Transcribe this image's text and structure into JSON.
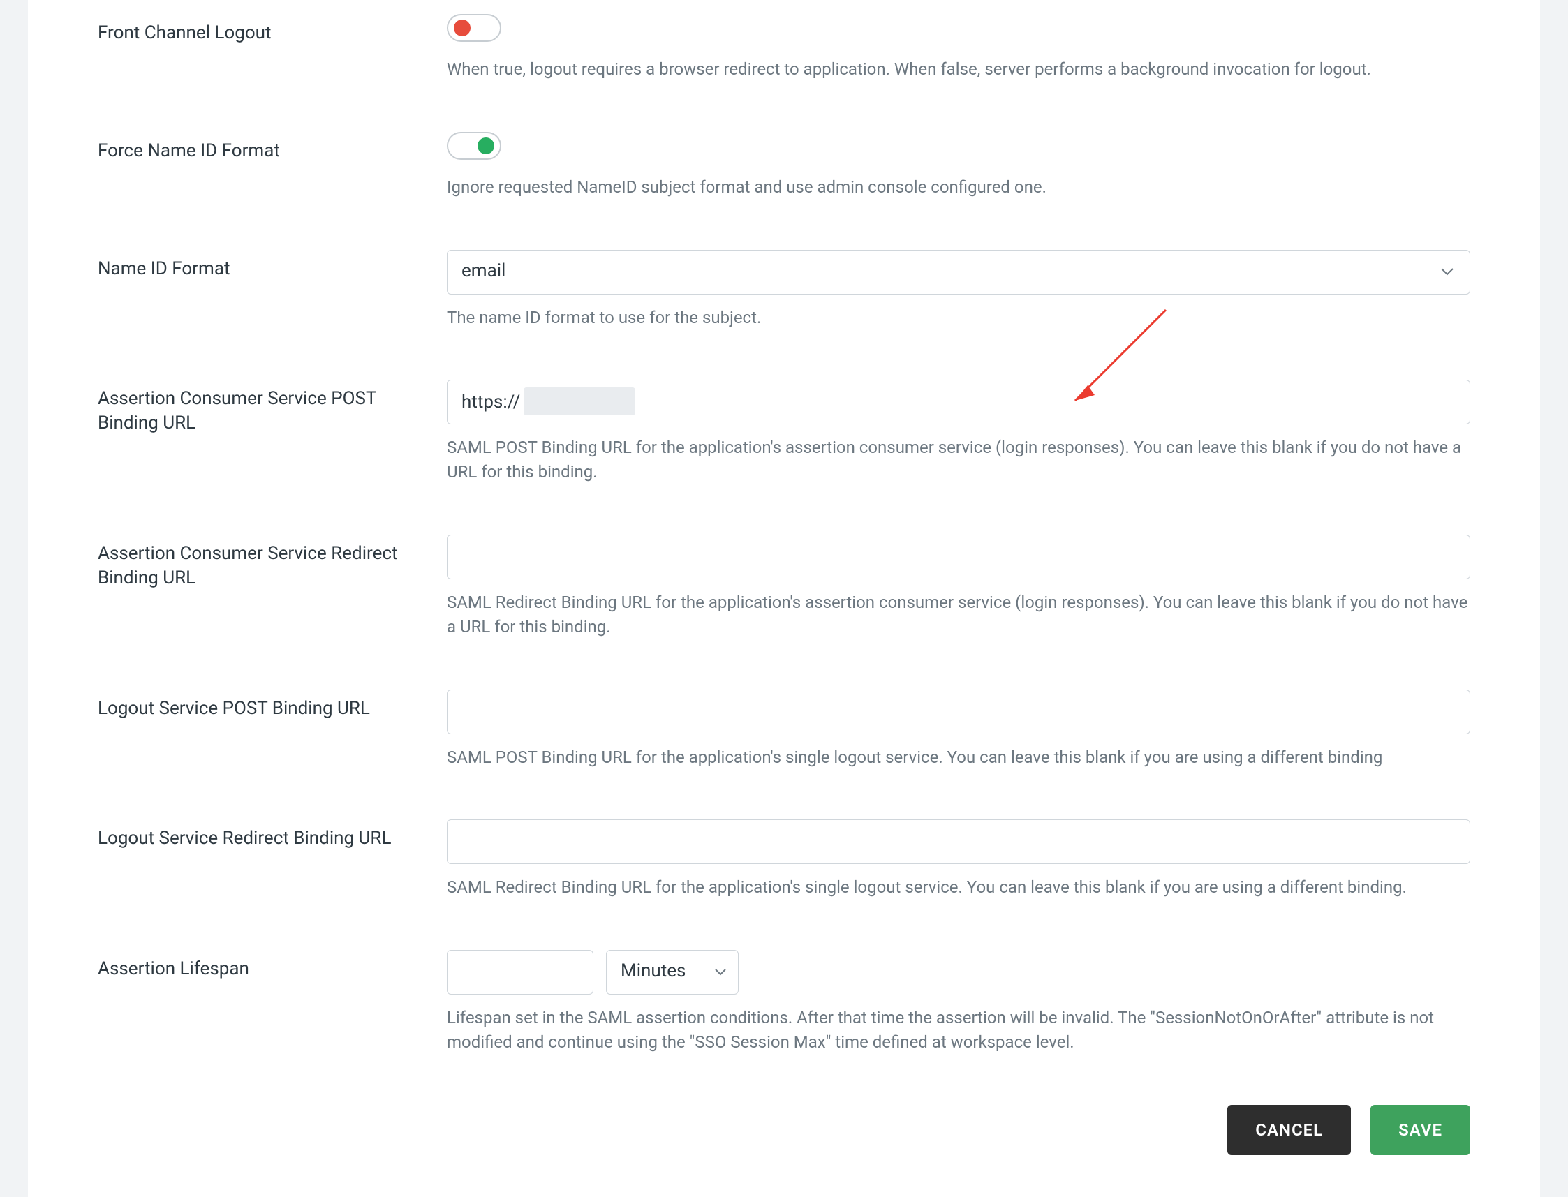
{
  "fields": {
    "front_channel_logout": {
      "label": "Front Channel Logout",
      "value": false,
      "help": "When true, logout requires a browser redirect to application. When false, server performs a background invocation for logout."
    },
    "force_name_id_format": {
      "label": "Force Name ID Format",
      "value": true,
      "help": "Ignore requested NameID subject format and use admin console configured one."
    },
    "name_id_format": {
      "label": "Name ID Format",
      "value": "email",
      "help": "The name ID format to use for the subject."
    },
    "acs_post_url": {
      "label": "Assertion Consumer Service POST Binding URL",
      "value": "https://",
      "help": "SAML POST Binding URL for the application's assertion consumer service (login responses). You can leave this blank if you do not have a URL for this binding."
    },
    "acs_redirect_url": {
      "label": "Assertion Consumer Service Redirect Binding URL",
      "value": "",
      "help": "SAML Redirect Binding URL for the application's assertion consumer service (login responses). You can leave this blank if you do not have a URL for this binding."
    },
    "logout_post_url": {
      "label": "Logout Service POST Binding URL",
      "value": "",
      "help": "SAML POST Binding URL for the application's single logout service. You can leave this blank if you are using a different binding"
    },
    "logout_redirect_url": {
      "label": "Logout Service Redirect Binding URL",
      "value": "",
      "help": "SAML Redirect Binding URL for the application's single logout service. You can leave this blank if you are using a different binding."
    },
    "assertion_lifespan": {
      "label": "Assertion Lifespan",
      "value": "",
      "unit": "Minutes",
      "help": "Lifespan set in the SAML assertion conditions. After that time the assertion will be invalid. The \"SessionNotOnOrAfter\" attribute is not modified and continue using the \"SSO Session Max\" time defined at workspace level."
    }
  },
  "buttons": {
    "cancel": "CANCEL",
    "save": "SAVE"
  },
  "colors": {
    "toggle_on": "#27ae60",
    "toggle_off": "#e74c3c",
    "save_btn": "#3ea25d",
    "cancel_btn": "#2e2e2e",
    "annotation_arrow": "#eb3b2f"
  }
}
